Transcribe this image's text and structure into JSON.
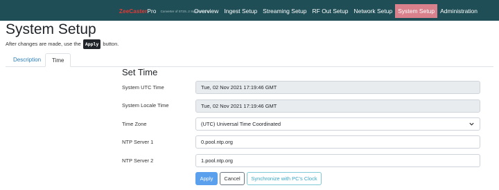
{
  "brand": {
    "logo_main": "ZeeCaster",
    "logo_accent": "Pro",
    "tagline": "Converter of ST2S..2 Signal to Q4m"
  },
  "nav": {
    "items": [
      {
        "label": "Overview",
        "active": false
      },
      {
        "label": "Ingest Setup",
        "active": false
      },
      {
        "label": "Streaming Setup",
        "active": false
      },
      {
        "label": "RF Out Setup",
        "active": false
      },
      {
        "label": "Network Setup",
        "active": false
      },
      {
        "label": "System Setup",
        "active": true
      },
      {
        "label": "Administration",
        "active": false
      }
    ]
  },
  "page": {
    "title": "System Setup",
    "hint_prefix": "After changes are made, use the",
    "hint_kbd": "Apply",
    "hint_suffix": "button."
  },
  "tabs": {
    "description": "Description",
    "time": "Time"
  },
  "form": {
    "section_title": "Set Time",
    "system_utc_time": {
      "label": "System UTC Time",
      "value": "Tue, 02 Nov 2021 17:19:46 GMT"
    },
    "system_locale_time": {
      "label": "System Locale Time",
      "value": "Tue, 02 Nov 2021 17:19:46 GMT"
    },
    "time_zone": {
      "label": "Time Zone",
      "value": "(UTC) Universal Time Coordinated"
    },
    "ntp_server_1": {
      "label": "NTP Server 1",
      "value": "0.pool.ntp.org"
    },
    "ntp_server_2": {
      "label": "NTP Server 2",
      "value": "1.pool.ntp.org"
    }
  },
  "buttons": {
    "apply": "Apply",
    "cancel": "Cancel",
    "sync": "Synchronize with PC's Clock"
  },
  "colors": {
    "topbar": "#1f4e56",
    "nav_active": "#d9808d",
    "apply": "#5aa0ec",
    "sync": "#3aa6c2",
    "link": "#2a7db8"
  }
}
